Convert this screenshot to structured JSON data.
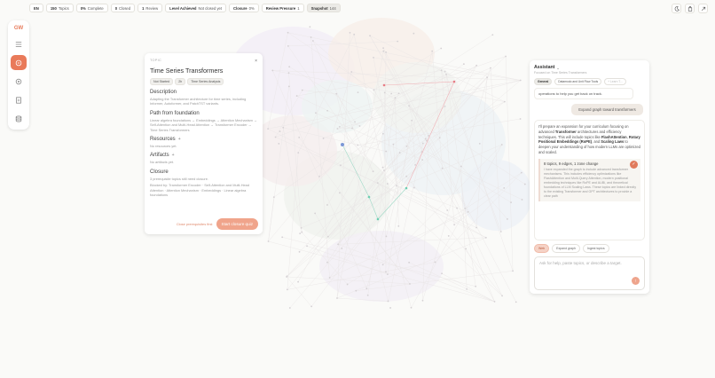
{
  "topbar": {
    "lang": "EN",
    "topics": {
      "value": "150",
      "label": "Topics"
    },
    "complete": {
      "value": "0%",
      "label": "Complete"
    },
    "closed": {
      "value": "0",
      "label": "Closed"
    },
    "review": {
      "value": "1",
      "label": "Review"
    },
    "level": {
      "label": "Level Achieved",
      "value": "Not closed yet"
    },
    "closure": {
      "label": "Closure",
      "value": "0%"
    },
    "pressure": {
      "label": "Review Pressure",
      "value": "1"
    },
    "snapshot": {
      "label": "Snapshot",
      "value": "144"
    }
  },
  "top_right_icons": [
    "moon-icon",
    "bag-icon",
    "share-icon"
  ],
  "rail": {
    "logo": "GW",
    "items": [
      "grid-icon",
      "chat-icon",
      "settings-icon",
      "notes-icon",
      "database-icon"
    ],
    "active": 1
  },
  "topic_panel": {
    "kicker": "TOPIC",
    "close": "×",
    "title": "Time Series Transformers",
    "tags": [
      "Not Started",
      "2h",
      "Time Series Analysis"
    ],
    "description_h": "Description",
    "description": "Adapting the Transformer architecture for time series, including Informer, Autoformer, and PatchTST variants.",
    "path_h": "Path from foundation",
    "path": "Linear algebra foundations → Embeddings → Attention Mechanism → Self-Attention and Multi-Head Attention → Transformer Encoder → Time Series Transformers",
    "resources_h": "Resources",
    "resources": "No resources yet.",
    "artifacts_h": "Artifacts",
    "artifacts": "No artifacts yet.",
    "closure_h": "Closure",
    "closure_p1": "3 prerequisite topics still need closure.",
    "closure_p2": "Blocked by: Transformer Encoder · Self-Attention and Multi-Head Attention · Attention Mechanism · Embeddings · Linear algebra foundations",
    "close_first": "Close prerequisites first",
    "start_btn": "Start closure quiz"
  },
  "assistant": {
    "title": "Assistant",
    "subtitle": "Focused on Time Series Transformers",
    "tabs": [
      "General",
      "Datamodo and Unit Flow Tools",
      "+ Learn T..."
    ],
    "msg_in": "operations to help you get back on track.",
    "msg_out": "Expand graph toward transformers",
    "reply_p1": "I'll prepare an expansion for your curriculum focusing on advanced ",
    "reply_b1": "Transformer",
    "reply_p2": " architectures and efficiency techniques. This will include topics like ",
    "reply_b2": "FlashAttention",
    "reply_p3": ", ",
    "reply_b3": "Rotary Positional Embeddings (RoPE)",
    "reply_p4": ", and ",
    "reply_b4": "Scaling Laws",
    "reply_p5": " to deepen your understanding of how modern LLMs are optimized and scaled.",
    "change_title": "8 topics, 9 edges, 1 zone change",
    "change_text": "I have expanded the graph to include advanced transformer mechanisms. This includes efficiency optimizations like FlashAttention and Multi-Query Attention, modern positional embedding techniques like RoPE and ALiBi, and theoretical foundations of LLM Scaling Laws. These topics are linked directly to the existing Transformer and GPT architectures to provide a clear path",
    "actions": [
      "Web",
      "Expand graph",
      "Ingest topics"
    ],
    "placeholder": "Ask for help, paste topics, or describe a target."
  },
  "colors": {
    "accent": "#e97a5a",
    "accent_light": "#f0a48b"
  }
}
